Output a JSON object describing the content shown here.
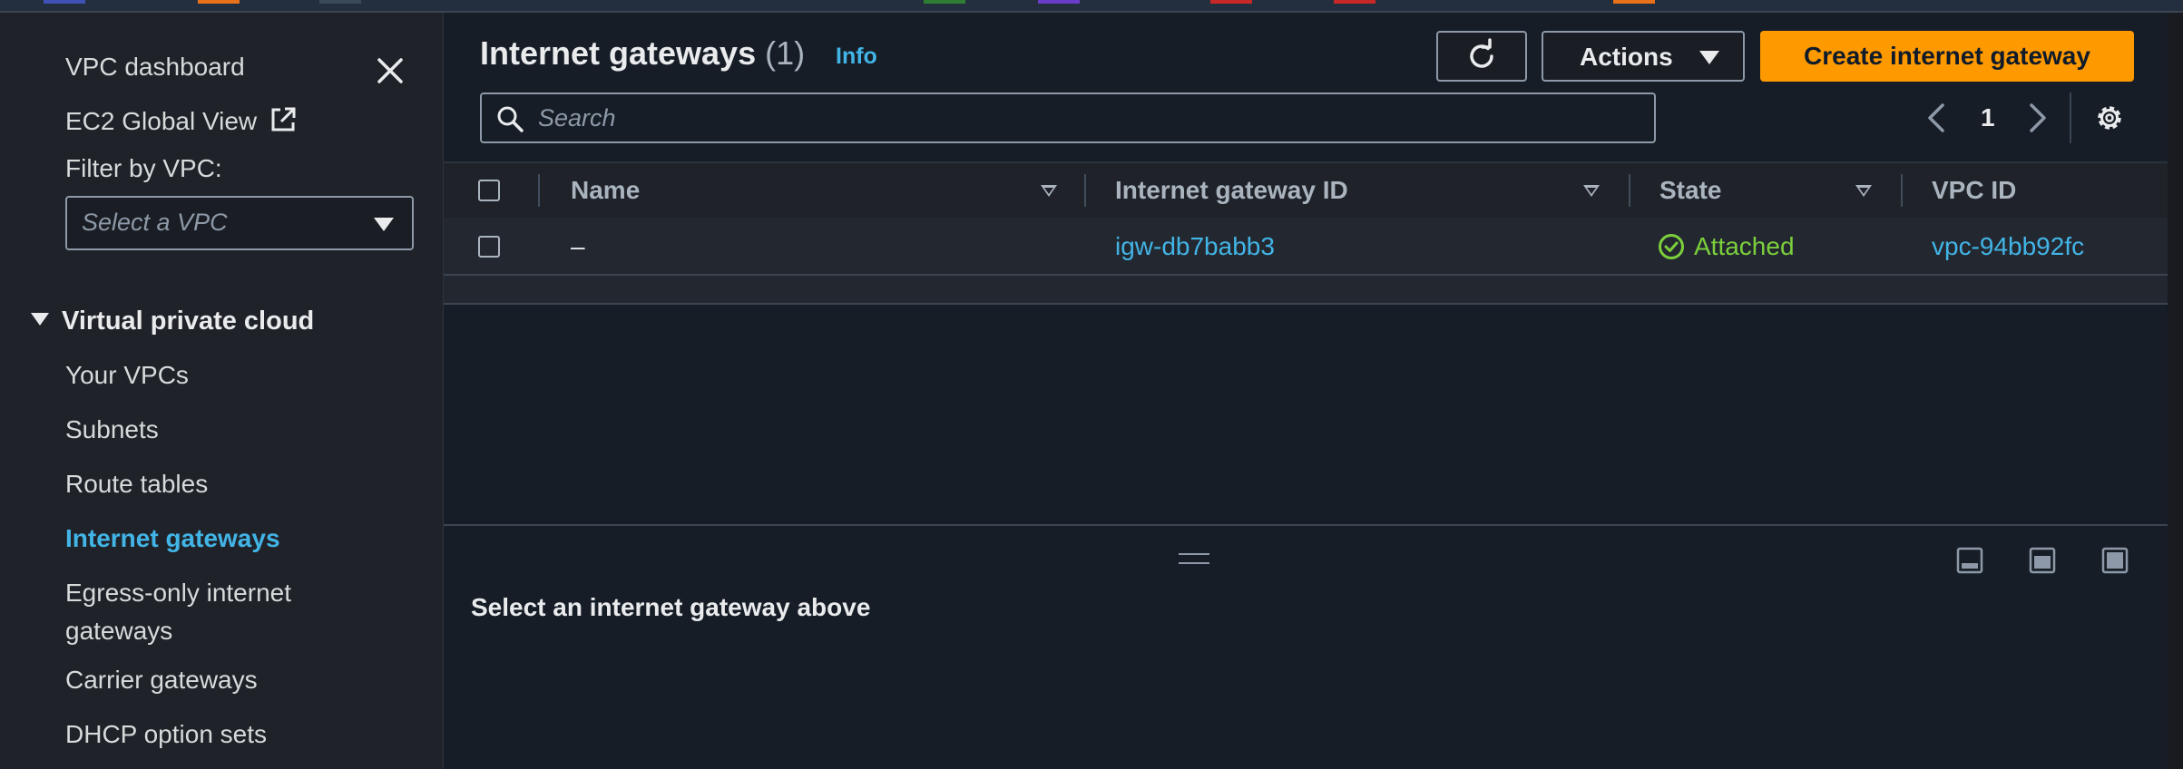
{
  "top_strip_colors": [
    "#3f51b5",
    "#e8711c",
    "#3a4a5a",
    "#2e7d32",
    "#6a3cc9",
    "#c62828",
    "#c62828",
    "#e8711c"
  ],
  "sidebar": {
    "dashboard": "VPC dashboard",
    "ec2_global_view": "EC2 Global View",
    "filter_label": "Filter by VPC:",
    "filter_placeholder": "Select a VPC",
    "section": "Virtual private cloud",
    "items": [
      {
        "label": "Your VPCs"
      },
      {
        "label": "Subnets"
      },
      {
        "label": "Route tables"
      },
      {
        "label": "Internet gateways",
        "active": true
      },
      {
        "label": "Egress-only internet",
        "label2": "gateways"
      },
      {
        "label": "Carrier gateways"
      },
      {
        "label": "DHCP option sets"
      }
    ]
  },
  "header": {
    "title": "Internet gateways",
    "count": "(1)",
    "info": "Info",
    "actions": "Actions",
    "create": "Create internet gateway"
  },
  "search": {
    "placeholder": "Search"
  },
  "pagination": {
    "page": "1"
  },
  "table": {
    "columns": [
      "Name",
      "Internet gateway ID",
      "State",
      "VPC ID"
    ],
    "rows": [
      {
        "name": "–",
        "id": "igw-db7babb3",
        "state": "Attached",
        "vpc": "vpc-94bb92fc"
      }
    ]
  },
  "detail_panel": {
    "message": "Select an internet gateway above"
  },
  "colors": {
    "accent": "#ff9900",
    "link": "#42b4e6",
    "success": "#7ccf3c"
  }
}
